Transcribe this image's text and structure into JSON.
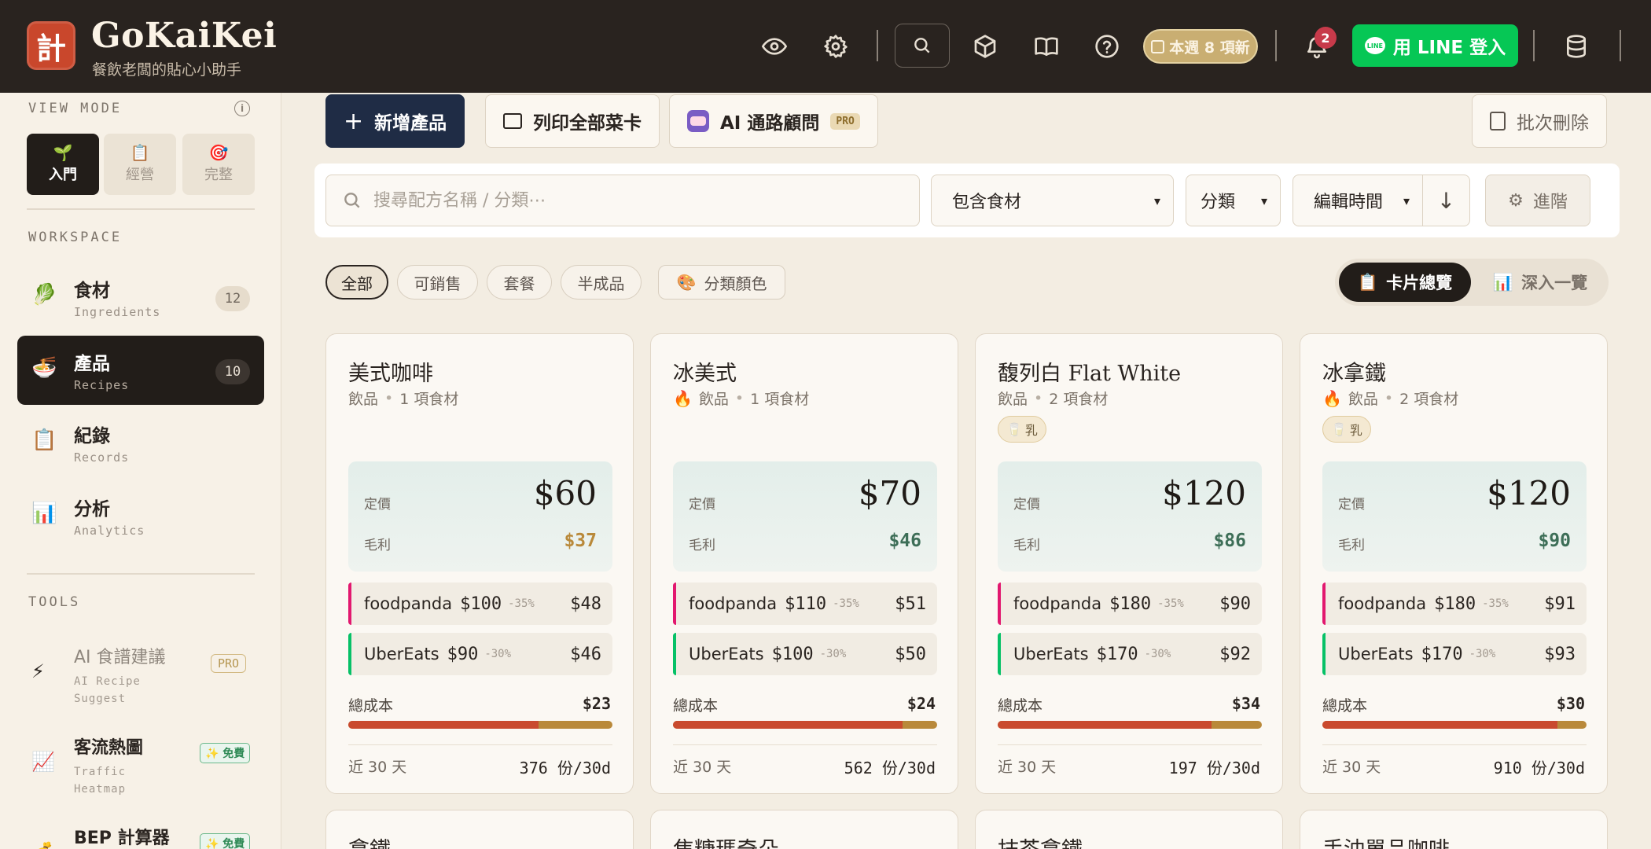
{
  "brand": {
    "logo_char": "計",
    "title": "GoKaiKei",
    "subtitle": "餐飲老闆的貼心小助手"
  },
  "topbar": {
    "icons": [
      "eye-icon",
      "gear-icon",
      "search-icon",
      "box-icon",
      "book-icon",
      "help-icon"
    ],
    "weekly_badge": "本週 8 項新",
    "notif_count": "2",
    "line_login": "用 LINE 登入",
    "line_logo": "LINE"
  },
  "sidebar": {
    "view_mode_label": "VIEW MODE",
    "modes": [
      {
        "label": "入門",
        "icon": "🌱"
      },
      {
        "label": "經營",
        "icon": "📋"
      },
      {
        "label": "完整",
        "icon": "🎯"
      }
    ],
    "workspace_label": "WORKSPACE",
    "nav": [
      {
        "title": "食材",
        "sub": "Ingredients",
        "count": "12",
        "icon": "🥬"
      },
      {
        "title": "產品",
        "sub": "Recipes",
        "count": "10",
        "icon": "🍜"
      },
      {
        "title": "紀錄",
        "sub": "Records",
        "icon": "📋"
      },
      {
        "title": "分析",
        "sub": "Analytics",
        "icon": "📊"
      }
    ],
    "tools_label": "TOOLS",
    "tools": [
      {
        "title": "AI 食譜建議",
        "sub1": "AI Recipe",
        "sub2": "Suggest",
        "badge": "PRO",
        "icon": "⚡"
      },
      {
        "title": "客流熱圖",
        "sub1": "Traffic",
        "sub2": "Heatmap",
        "badge": "✨ 免費",
        "icon": "📈"
      },
      {
        "title": "BEP 計算器",
        "badge": "✨ 免費",
        "icon": "💰"
      }
    ]
  },
  "actions": {
    "add_product": "新增產品",
    "print_all": "列印全部菜卡",
    "ai_advisor": "AI 通路顧問",
    "ai_badge": "PRO",
    "batch_delete": "批次刪除"
  },
  "filters": {
    "search_placeholder": "搜尋配方名稱 / 分類⋯",
    "ingredient_select": "包含食材",
    "category_select": "分類",
    "sort_select": "編輯時間",
    "sort_dir": "↓",
    "advanced": "進階"
  },
  "chips": [
    "全部",
    "可銷售",
    "套餐",
    "半成品"
  ],
  "color_chip": "分類顏色",
  "view_toggle": {
    "cards": "卡片總覽",
    "detail": "深入一覽"
  },
  "card_labels": {
    "price": "定價",
    "margin": "毛利",
    "total_cost": "總成本",
    "last30": "近 30 天"
  },
  "cards": [
    {
      "title": "美式咖啡",
      "flame": false,
      "category": "飲品",
      "ingredients": "1 項食材",
      "allergen": "",
      "price": "$60",
      "margin": "$37",
      "margin_warn": true,
      "foodpanda": {
        "name": "foodpanda",
        "price": "$100",
        "cut": "-35%",
        "net": "$48"
      },
      "ubereats": {
        "name": "UberEats",
        "price": "$90",
        "cut": "-30%",
        "net": "$46"
      },
      "cost": "$23",
      "cost_ratio": 0.72,
      "sales": "376 份/30d"
    },
    {
      "title": "冰美式",
      "flame": true,
      "category": "飲品",
      "ingredients": "1 項食材",
      "allergen": "",
      "price": "$70",
      "margin": "$46",
      "margin_warn": false,
      "foodpanda": {
        "name": "foodpanda",
        "price": "$110",
        "cut": "-35%",
        "net": "$51"
      },
      "ubereats": {
        "name": "UberEats",
        "price": "$100",
        "cut": "-30%",
        "net": "$50"
      },
      "cost": "$24",
      "cost_ratio": 0.87,
      "sales": "562 份/30d"
    },
    {
      "title": "馥列白 Flat White",
      "flame": false,
      "category": "飲品",
      "ingredients": "2 項食材",
      "allergen": "乳",
      "price": "$120",
      "margin": "$86",
      "margin_warn": false,
      "foodpanda": {
        "name": "foodpanda",
        "price": "$180",
        "cut": "-35%",
        "net": "$90"
      },
      "ubereats": {
        "name": "UberEats",
        "price": "$170",
        "cut": "-30%",
        "net": "$92"
      },
      "cost": "$34",
      "cost_ratio": 0.81,
      "sales": "197 份/30d"
    },
    {
      "title": "冰拿鐵",
      "flame": true,
      "category": "飲品",
      "ingredients": "2 項食材",
      "allergen": "乳",
      "price": "$120",
      "margin": "$90",
      "margin_warn": false,
      "foodpanda": {
        "name": "foodpanda",
        "price": "$180",
        "cut": "-35%",
        "net": "$91"
      },
      "ubereats": {
        "name": "UberEats",
        "price": "$170",
        "cut": "-30%",
        "net": "$93"
      },
      "cost": "$30",
      "cost_ratio": 0.89,
      "sales": "910 份/30d"
    }
  ],
  "peek_cards": [
    "拿鐵",
    "焦糖瑪奇朵",
    "抹茶拿鐵",
    "手沖單品咖啡"
  ],
  "colors": {
    "brand": "#c9472c",
    "line": "#06c755",
    "foodpanda": "#e2186f",
    "ubereats": "#06c167",
    "cost": "#c94a2e"
  }
}
